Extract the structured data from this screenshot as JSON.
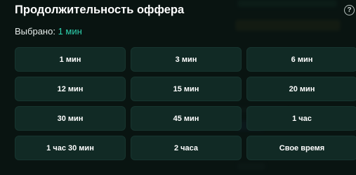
{
  "modal": {
    "title": "Продолжительность оффера",
    "help_icon": "question-circle-icon",
    "help_glyph": "?",
    "selected_label": "Выбрано:",
    "selected_value": "1 мин"
  },
  "options": [
    "1 мин",
    "3 мин",
    "6 мин",
    "12 мин",
    "15 мин",
    "20 мин",
    "30 мин",
    "45 мин",
    "1 час",
    "1 час 30 мин",
    "2 часа",
    "Свое время"
  ],
  "colors": {
    "accent": "#2fd3b0",
    "option_bg": "#112a25",
    "background": "#0b1614"
  }
}
